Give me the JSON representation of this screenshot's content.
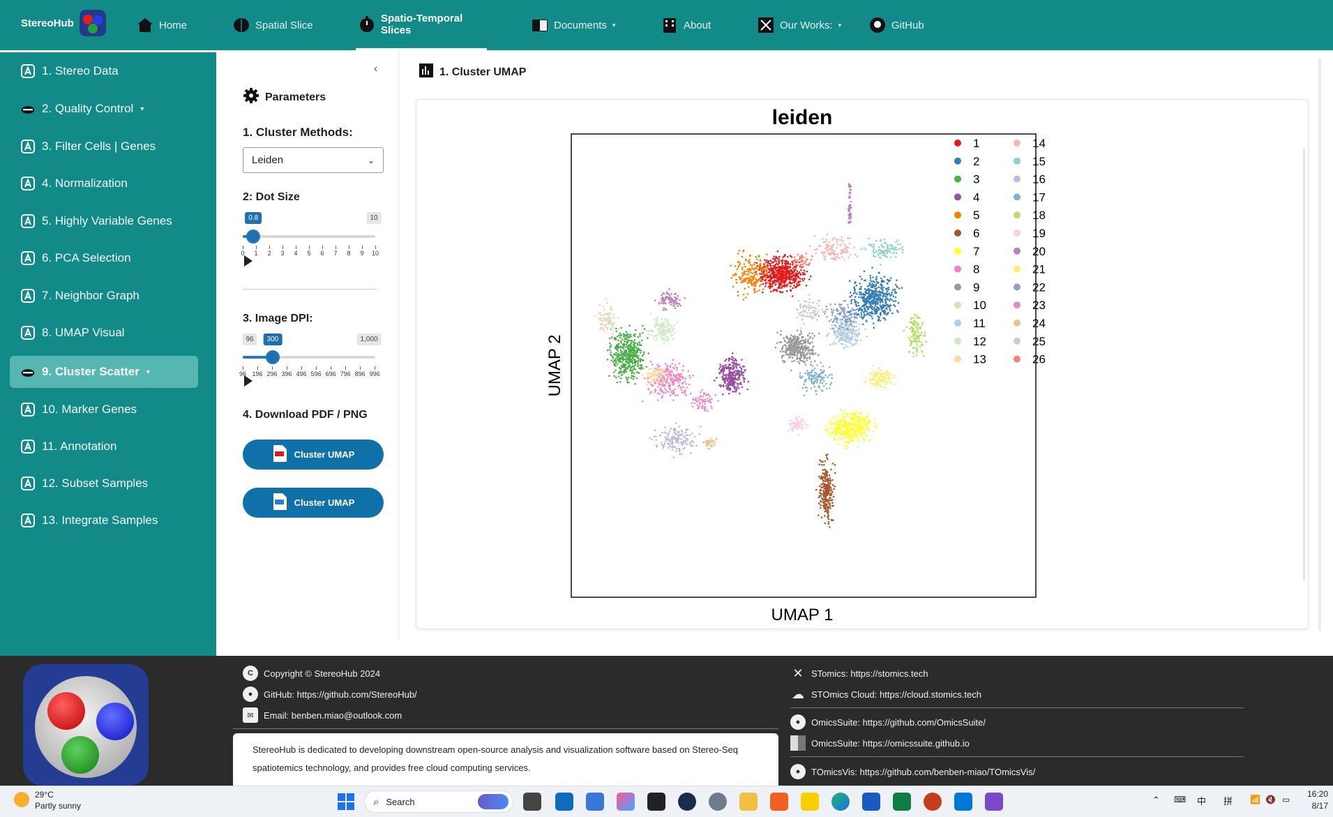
{
  "brand": {
    "name": "StereoHub"
  },
  "nav": [
    {
      "label": "Home",
      "icon": "home-icon"
    },
    {
      "label": "Spatial Slice",
      "icon": "brain-icon"
    },
    {
      "label": "Spatio-Temporal Slices",
      "icon": "clock-icon"
    },
    {
      "label": "Documents",
      "icon": "book-icon"
    },
    {
      "label": "About",
      "icon": "building-icon"
    },
    {
      "label": "Our Works:",
      "icon": "tools-icon"
    },
    {
      "label": "GitHub",
      "icon": "github-icon"
    }
  ],
  "sidebar": [
    {
      "label": "1. Stereo Data"
    },
    {
      "label": "2. Quality Control"
    },
    {
      "label": "3. Filter Cells | Genes"
    },
    {
      "label": "4. Normalization"
    },
    {
      "label": "5. Highly Variable Genes"
    },
    {
      "label": "6. PCA Selection"
    },
    {
      "label": "7. Neighbor Graph"
    },
    {
      "label": "8. UMAP Visual"
    },
    {
      "label": "9. Cluster Scatter"
    },
    {
      "label": "10. Marker Genes"
    },
    {
      "label": "11. Annotation"
    },
    {
      "label": "12. Subset Samples"
    },
    {
      "label": "13. Integrate Samples"
    }
  ],
  "params": {
    "title": "Parameters",
    "method_label": "1. Cluster Methods:",
    "method_value": "Leiden",
    "dot_label": "2: Dot Size",
    "dot_value": "0.8",
    "dot_max": "10",
    "dot_value_num": 0.8,
    "dot_ticks": [
      "0",
      "1",
      "2",
      "3",
      "4",
      "5",
      "6",
      "7",
      "8",
      "9",
      "10"
    ],
    "dpi_label": "3. Image DPI:",
    "dpi_min": "96",
    "dpi_value": "300",
    "dpi_max": "1,000",
    "dpi_value_num": 300,
    "dpi_ticks": [
      "96",
      "196",
      "296",
      "396",
      "496",
      "596",
      "696",
      "796",
      "896",
      "996"
    ],
    "download_label": "4. Download PDF / PNG",
    "btn_pdf": "Cluster UMAP",
    "btn_png": "Cluster UMAP"
  },
  "main": {
    "title": "1. Cluster UMAP"
  },
  "chart_data": {
    "type": "scatter",
    "title": "leiden",
    "xlabel": "UMAP 1",
    "ylabel": "UMAP 2",
    "grid": false,
    "legend_placement": "right",
    "series": [
      {
        "name": "1",
        "color": "#e41a1c"
      },
      {
        "name": "2",
        "color": "#377eb8"
      },
      {
        "name": "3",
        "color": "#4daf4a"
      },
      {
        "name": "4",
        "color": "#984ea3"
      },
      {
        "name": "5",
        "color": "#ff7f00"
      },
      {
        "name": "6",
        "color": "#a65628"
      },
      {
        "name": "7",
        "color": "#ffff33"
      },
      {
        "name": "8",
        "color": "#f781bf"
      },
      {
        "name": "9",
        "color": "#999999"
      },
      {
        "name": "10",
        "color": "#e5d8bd"
      },
      {
        "name": "11",
        "color": "#b3cde3"
      },
      {
        "name": "12",
        "color": "#ccebc5"
      },
      {
        "name": "13",
        "color": "#fed9a6"
      },
      {
        "name": "14",
        "color": "#fbb4ae"
      },
      {
        "name": "15",
        "color": "#8dd3c7"
      },
      {
        "name": "16",
        "color": "#bebada"
      },
      {
        "name": "17",
        "color": "#80b1d3"
      },
      {
        "name": "18",
        "color": "#b3de69"
      },
      {
        "name": "19",
        "color": "#fccde5"
      },
      {
        "name": "20",
        "color": "#bc80bd"
      },
      {
        "name": "21",
        "color": "#ffed6f"
      },
      {
        "name": "22",
        "color": "#8da0cb"
      },
      {
        "name": "23",
        "color": "#e78ac3"
      },
      {
        "name": "24",
        "color": "#e5c494"
      },
      {
        "name": "25",
        "color": "#cccccc"
      },
      {
        "name": "26",
        "color": "#fb8072"
      }
    ]
  },
  "footer": {
    "copyright": "Copyright © StereoHub 2024",
    "github": "GitHub: https://github.com/StereoHub/",
    "email": "Email: benben.miao@outlook.com",
    "description": "StereoHub is dedicated to developing downstream open-source analysis and visualization software based on Stereo-Seq spatiotemics technology, and provides free cloud computing services.",
    "stomics": "STomics: https://stomics.tech",
    "stomics_cloud": "STOmics Cloud: https://cloud.stomics.tech",
    "omicssuite_gh": "OmicsSuite: https://github.com/OmicsSuite/",
    "omicssuite_io": "OmicsSuite: https://omicssuite.github.io",
    "tomicsvis": "TOmicsVis: https://github.com/benben-miao/TOmicsVis/"
  },
  "taskbar": {
    "weather_temp": "29°C",
    "weather_desc": "Partly sunny",
    "search": "Search",
    "time": "16:20",
    "date": "8/17",
    "ime1": "中",
    "ime2": "拼"
  }
}
